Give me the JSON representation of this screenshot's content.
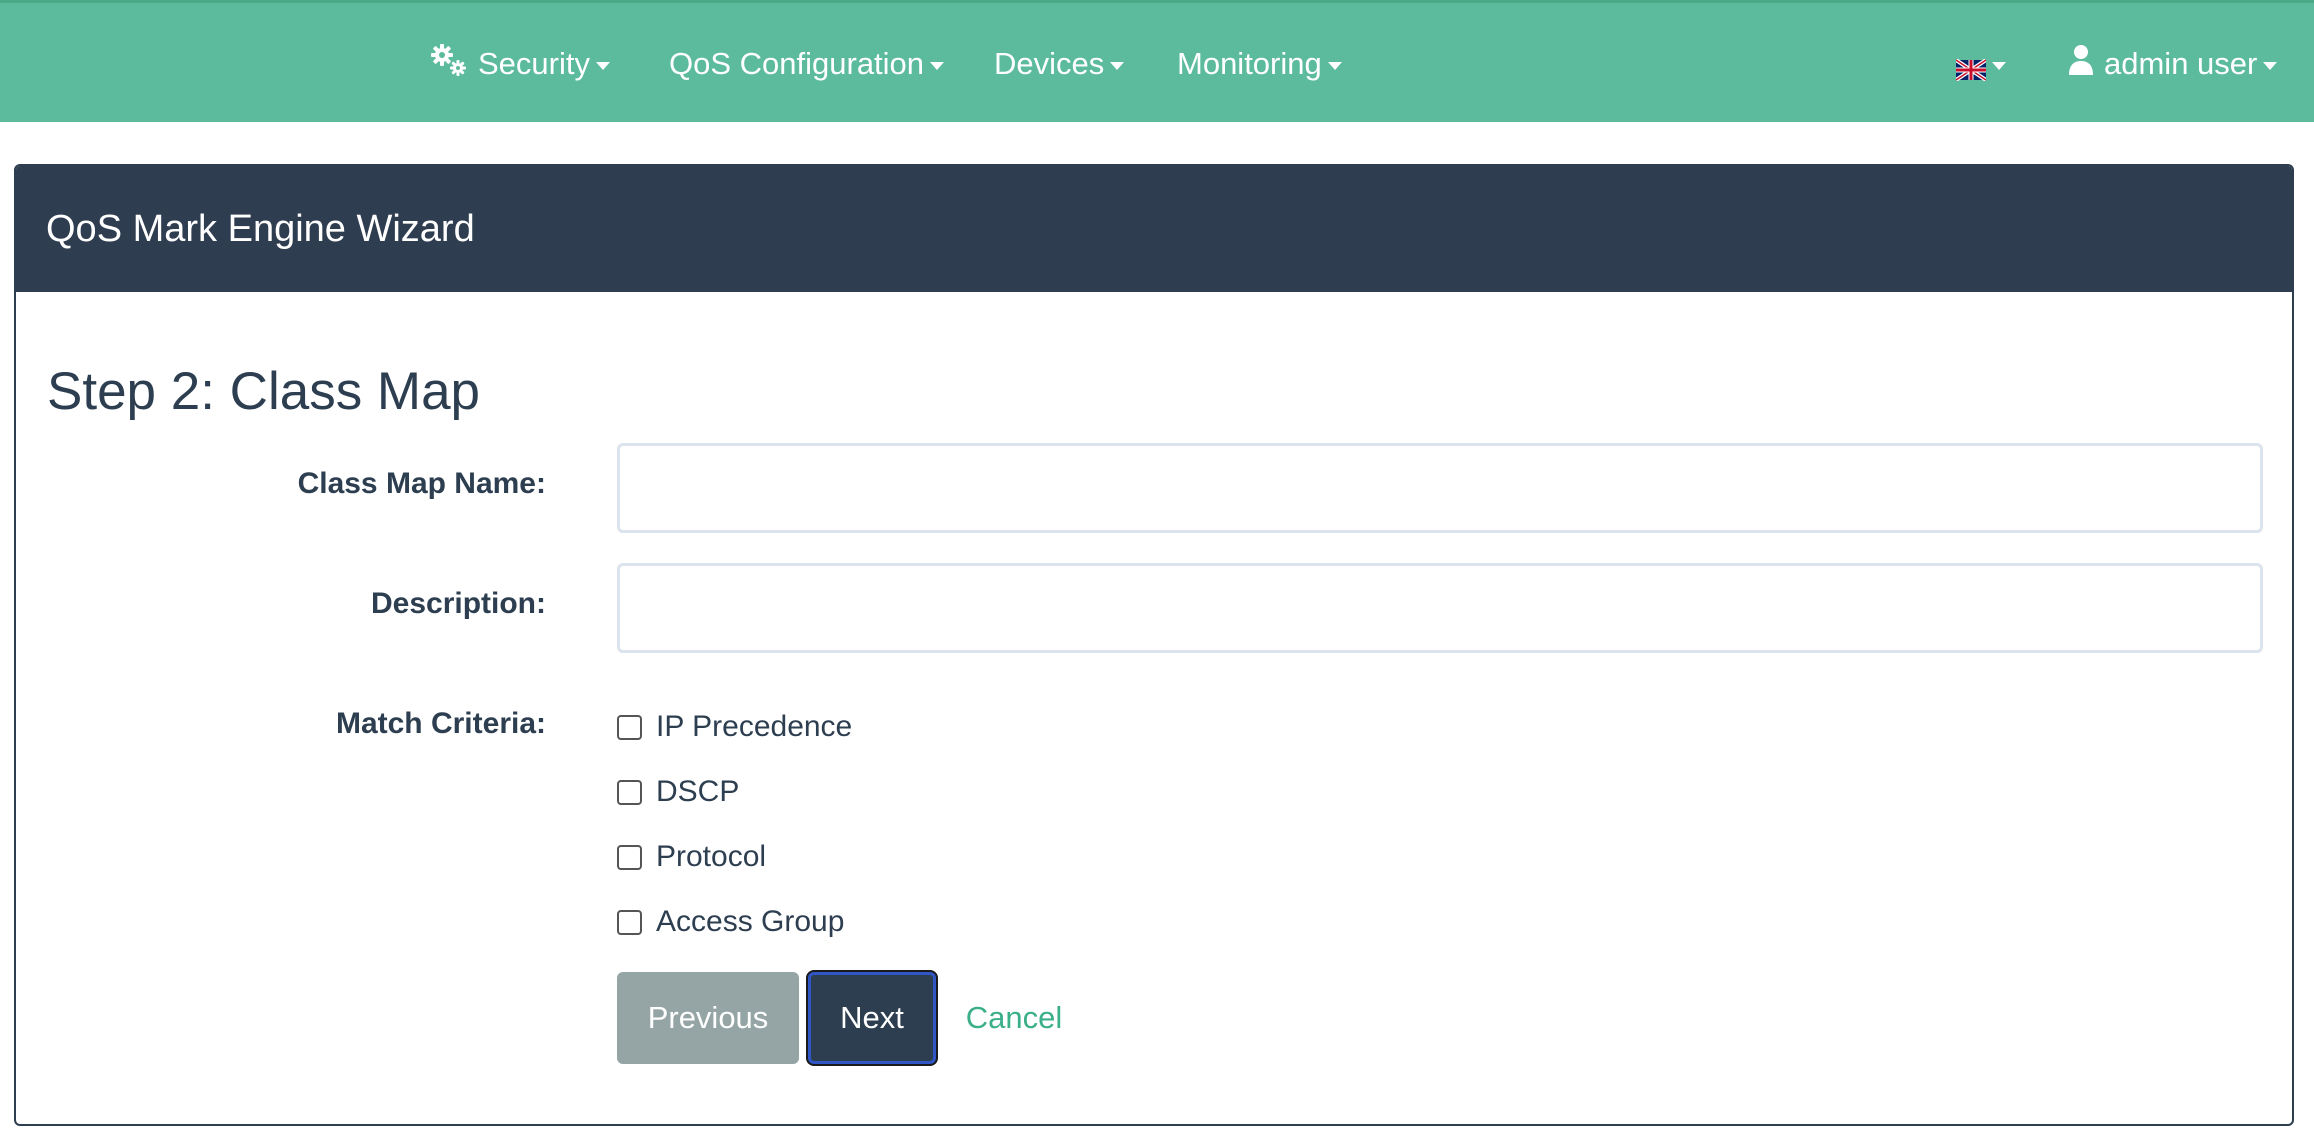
{
  "navbar": {
    "security_label": "Security",
    "qos_label": "QoS Configuration",
    "devices_label": "Devices",
    "monitoring_label": "Monitoring",
    "language_icon": "uk-flag-icon",
    "user_label": "admin user"
  },
  "wizard": {
    "title": "QoS Mark Engine Wizard",
    "step_title": "Step 2: Class Map",
    "fields": {
      "class_map_name_label": "Class Map Name:",
      "class_map_name_value": "",
      "description_label": "Description:",
      "description_value": "",
      "match_criteria_label": "Match Criteria:"
    },
    "criteria": [
      {
        "label": "IP Precedence",
        "checked": false
      },
      {
        "label": "DSCP",
        "checked": false
      },
      {
        "label": "Protocol",
        "checked": false
      },
      {
        "label": "Access Group",
        "checked": false
      }
    ],
    "buttons": {
      "previous": "Previous",
      "next": "Next",
      "cancel": "Cancel"
    }
  },
  "colors": {
    "navbar": "#5bbb9c",
    "panel_header": "#2f3d50",
    "text": "#2c3e50",
    "previous_button": "#95a5a6",
    "next_button": "#2c3e50",
    "link": "#3aaf8a"
  }
}
